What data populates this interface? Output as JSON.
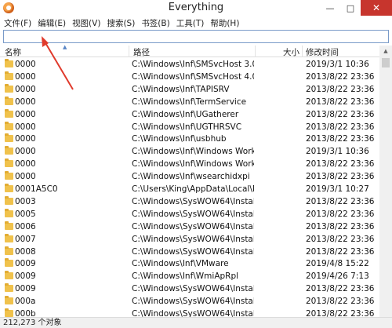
{
  "window": {
    "title": "Everything",
    "buttons": {
      "minimize": "—",
      "maximize": "□",
      "close": "✕"
    }
  },
  "menu": [
    "文件(F)",
    "编辑(E)",
    "视图(V)",
    "搜索(S)",
    "书签(B)",
    "工具(T)",
    "帮助(H)"
  ],
  "search": {
    "value": "",
    "placeholder": ""
  },
  "columns": {
    "name": "名称",
    "path": "路径",
    "size": "大小",
    "modified": "修改时间"
  },
  "rows": [
    {
      "name": "0000",
      "path": "C:\\Windows\\Inf\\SMSvcHost 3.0....",
      "modified": "2019/3/1 10:36"
    },
    {
      "name": "0000",
      "path": "C:\\Windows\\Inf\\SMSvcHost 4.0....",
      "modified": "2013/8/22 23:36"
    },
    {
      "name": "0000",
      "path": "C:\\Windows\\Inf\\TAPISRV",
      "modified": "2013/8/22 23:36"
    },
    {
      "name": "0000",
      "path": "C:\\Windows\\Inf\\TermService",
      "modified": "2013/8/22 23:36"
    },
    {
      "name": "0000",
      "path": "C:\\Windows\\Inf\\UGatherer",
      "modified": "2013/8/22 23:36"
    },
    {
      "name": "0000",
      "path": "C:\\Windows\\Inf\\UGTHRSVC",
      "modified": "2013/8/22 23:36"
    },
    {
      "name": "0000",
      "path": "C:\\Windows\\Inf\\usbhub",
      "modified": "2013/8/22 23:36"
    },
    {
      "name": "0000",
      "path": "C:\\Windows\\Inf\\Windows Workf...",
      "modified": "2019/3/1 10:36"
    },
    {
      "name": "0000",
      "path": "C:\\Windows\\Inf\\Windows Workf...",
      "modified": "2013/8/22 23:36"
    },
    {
      "name": "0000",
      "path": "C:\\Windows\\Inf\\wsearchidxpi",
      "modified": "2013/8/22 23:36"
    },
    {
      "name": "0001A5C0",
      "path": "C:\\Users\\King\\AppData\\Local\\M...",
      "modified": "2019/3/1 10:27"
    },
    {
      "name": "0003",
      "path": "C:\\Windows\\SysWOW64\\InstallS...",
      "modified": "2013/8/22 23:36"
    },
    {
      "name": "0005",
      "path": "C:\\Windows\\SysWOW64\\InstallS...",
      "modified": "2013/8/22 23:36"
    },
    {
      "name": "0006",
      "path": "C:\\Windows\\SysWOW64\\InstallS...",
      "modified": "2013/8/22 23:36"
    },
    {
      "name": "0007",
      "path": "C:\\Windows\\SysWOW64\\InstallS...",
      "modified": "2013/8/22 23:36"
    },
    {
      "name": "0008",
      "path": "C:\\Windows\\SysWOW64\\InstallS...",
      "modified": "2013/8/22 23:36"
    },
    {
      "name": "0009",
      "path": "C:\\Windows\\Inf\\VMware",
      "modified": "2019/4/8 15:22"
    },
    {
      "name": "0009",
      "path": "C:\\Windows\\Inf\\WmiApRpl",
      "modified": "2019/4/26 7:13"
    },
    {
      "name": "0009",
      "path": "C:\\Windows\\SysWOW64\\InstallS...",
      "modified": "2013/8/22 23:36"
    },
    {
      "name": "000a",
      "path": "C:\\Windows\\SysWOW64\\InstallS...",
      "modified": "2013/8/22 23:36"
    },
    {
      "name": "000b",
      "path": "C:\\Windows\\SysWOW64\\InstallS...",
      "modified": "2013/8/22 23:36"
    }
  ],
  "status": {
    "text": "212,273 个对象"
  },
  "colors": {
    "accent": "#3a6fb5",
    "close": "#c7352d",
    "folder": "#f0c24c",
    "arrow": "#e03a2c"
  }
}
